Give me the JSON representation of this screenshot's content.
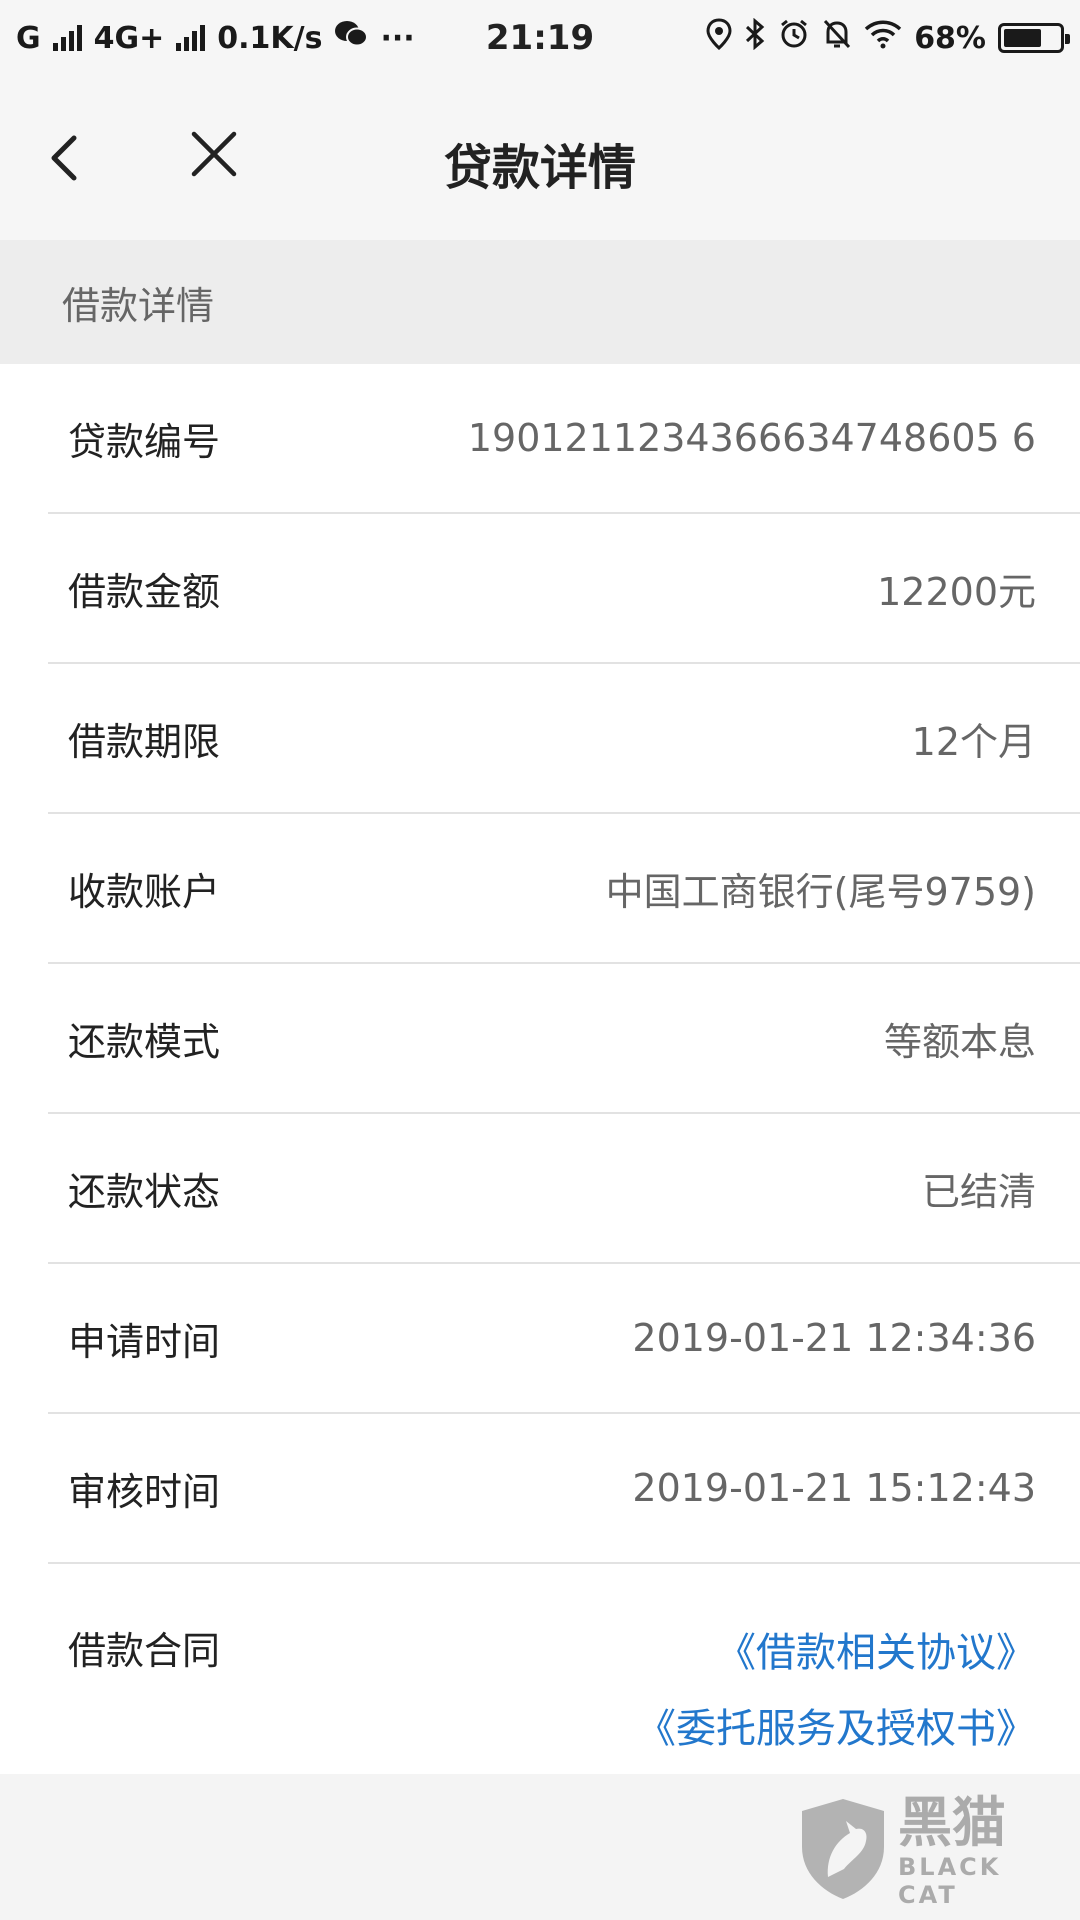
{
  "status_bar": {
    "carrier1": "G",
    "network": "4G+",
    "speed": "0.1K/s",
    "dots": "···",
    "time": "21:19",
    "battery": "68%",
    "battery_level": 0.68,
    "icons": [
      "signal-icon",
      "wechat-icon",
      "location-icon",
      "bluetooth-icon",
      "alarm-icon",
      "mute-icon",
      "wifi-icon",
      "battery-icon"
    ]
  },
  "nav": {
    "title": "贷款详情",
    "back_icon": "chevron-left-icon",
    "close_icon": "close-icon"
  },
  "section": {
    "title": "借款详情"
  },
  "rows": [
    {
      "label": "贷款编号",
      "value": "1901211234366634748605 6"
    },
    {
      "label": "借款金额",
      "value": "12200元"
    },
    {
      "label": "借款期限",
      "value": "12个月"
    },
    {
      "label": "收款账户",
      "value": "中国工商银行(尾号9759)"
    },
    {
      "label": "还款模式",
      "value": "等额本息"
    },
    {
      "label": "还款状态",
      "value": "已结清"
    },
    {
      "label": "申请时间",
      "value": "2019-01-21 12:34:36"
    },
    {
      "label": "审核时间",
      "value": "2019-01-21 15:12:43"
    }
  ],
  "contract": {
    "label": "借款合同",
    "links": [
      "《借款相关协议》",
      "《委托服务及授权书》"
    ]
  },
  "watermark": {
    "cn": "黑猫",
    "en": "BLACK CAT"
  },
  "colors": {
    "link": "#2277cc",
    "section_bg": "#ededed",
    "row_bg": "#ffffff"
  }
}
